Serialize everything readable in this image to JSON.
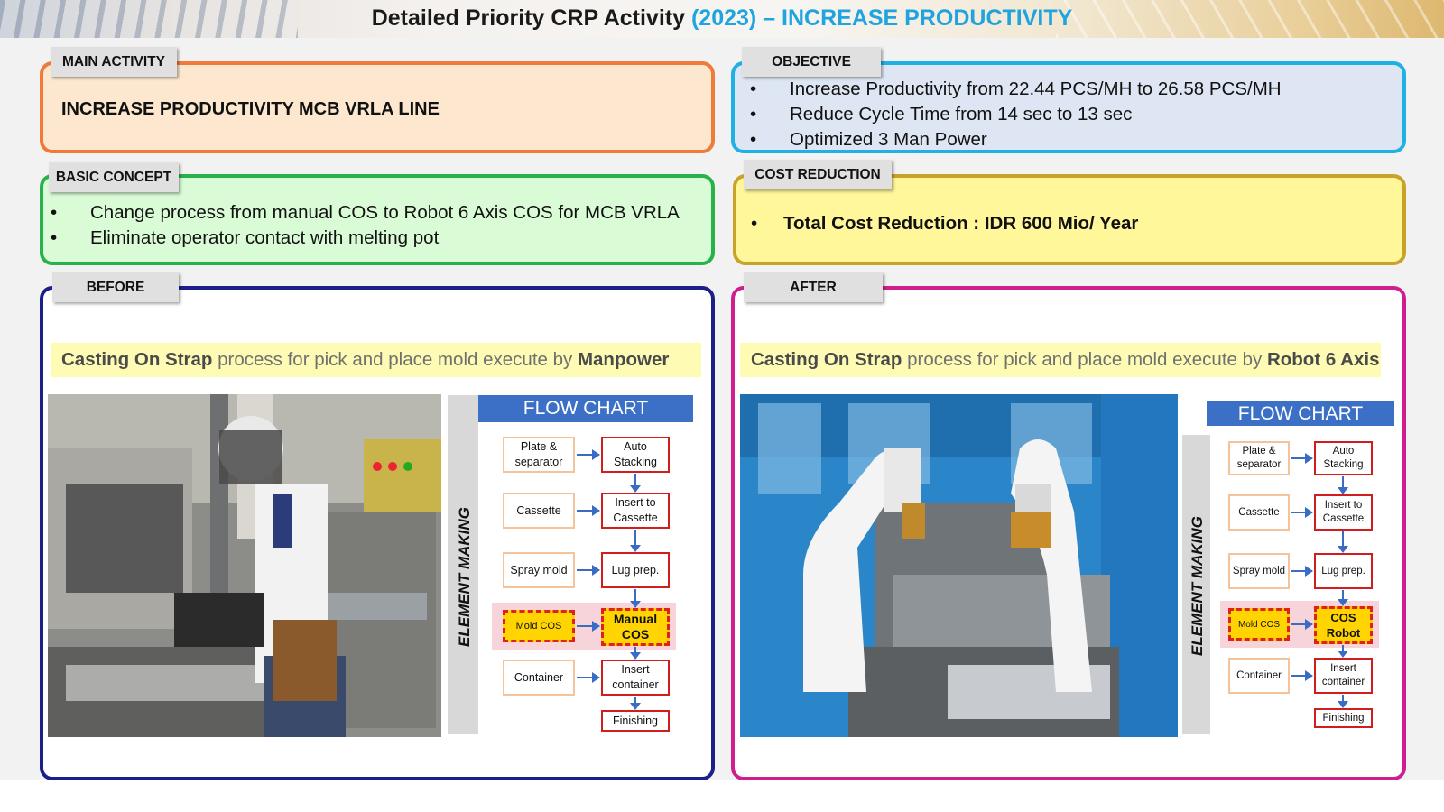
{
  "header": {
    "title_part1": "Detailed Priority CRP Activity ",
    "title_part2": "(2023) – INCREASE PRODUCTIVITY"
  },
  "main_activity": {
    "tab": "MAIN ACTIVITY",
    "text": "INCREASE PRODUCTIVITY MCB VRLA LINE"
  },
  "objective": {
    "tab": "OBJECTIVE",
    "items": [
      "Increase Productivity from 22.44 PCS/MH to 26.58 PCS/MH",
      "Reduce Cycle Time from 14 sec to 13 sec",
      "Optimized 3 Man Power"
    ]
  },
  "basic_concept": {
    "tab": "BASIC CONCEPT",
    "items": [
      "Change process from manual COS to Robot 6 Axis COS for MCB VRLA",
      "Eliminate operator contact with melting pot"
    ]
  },
  "cost_reduction": {
    "tab": "COST REDUCTION",
    "bullet": "•",
    "text": "Total Cost Reduction : IDR 600 Mio/ Year"
  },
  "before": {
    "tab": "BEFORE",
    "caption_bold1": "Casting On Strap",
    "caption_mid": " process for pick and place mold execute by ",
    "caption_bold2": "Manpower",
    "flow": {
      "title": "FLOW CHART",
      "side_label": "ELEMENT MAKING",
      "left": [
        "Plate & separator",
        "Cassette",
        "Spray mold",
        "Mold COS",
        "Container"
      ],
      "right": [
        "Auto Stacking",
        "Insert to Cassette",
        "Lug prep.",
        "Manual COS",
        "Insert container",
        "Finishing"
      ]
    }
  },
  "after": {
    "tab": "AFTER",
    "caption_bold1": "Casting On Strap",
    "caption_mid": " process for pick and place mold execute by ",
    "caption_bold2": "Robot 6 Axis",
    "flow": {
      "title": "FLOW CHART",
      "side_label": "ELEMENT MAKING",
      "left": [
        "Plate & separator",
        "Cassette",
        "Spray mold",
        "Mold COS",
        "Container"
      ],
      "right": [
        "Auto Stacking",
        "Insert to Cassette",
        "Lug prep.",
        "COS Robot",
        "Insert container",
        "Finishing"
      ]
    }
  },
  "colors": {
    "title_accent": "#20a4e0",
    "main_border": "#f07a3a",
    "objective_border": "#1fb0e4",
    "basic_border": "#27b24a",
    "cost_border": "#c9a228",
    "before_border": "#1c1f8a",
    "after_border": "#d01e8e",
    "flow_header": "#3c6fc6",
    "highlight_yellow": "#ffd400"
  }
}
